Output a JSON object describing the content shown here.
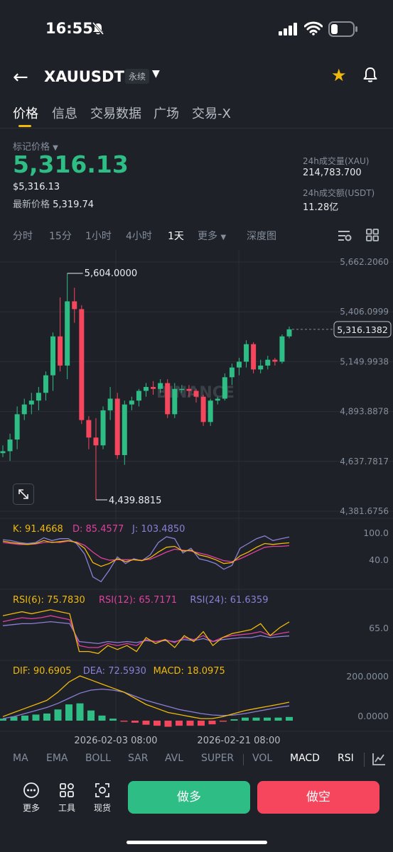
{
  "status": {
    "time": "16:55"
  },
  "header": {
    "symbol": "XAUUSDT",
    "contract_type": "永续"
  },
  "tabs": [
    "价格",
    "信息",
    "交易数据",
    "广场",
    "交易-X"
  ],
  "ticker": {
    "mark_label": "标记价格",
    "mark_price": "5,316.13",
    "usd_value": "$5,316.13",
    "last_price_label": "最新价格",
    "last_price": "5,319.74",
    "vol_base_label": "24h成交量(XAU)",
    "vol_base": "214,783.700",
    "vol_quote_label": "24h成交额(USDT)",
    "vol_quote": "11.28亿"
  },
  "intervals": [
    "分时",
    "15分",
    "1小时",
    "4小时",
    "1天",
    "更多",
    "深度图"
  ],
  "active_interval": "1天",
  "chart": {
    "price_axis": [
      "5,662.2060",
      "5,406.0999",
      "5,149.9938",
      "4,893.8878",
      "4,637.7817",
      "4,381.6756"
    ],
    "current_price_tag": "5,316.1382",
    "high_label": "5,604.0000",
    "low_label": "4,439.8815",
    "watermark": "BINANCE",
    "time_labels": [
      "2026-02-03 08:00",
      "2026-02-21 08:00"
    ],
    "kdj": {
      "k_label": "K: 91.4668",
      "d_label": "D: 85.4577",
      "j_label": "J: 103.4850",
      "axis": [
        "100.0",
        "40.0"
      ]
    },
    "rsi": {
      "rsi6_label": "RSI(6): 75.7830",
      "rsi12_label": "RSI(12): 65.7171",
      "rsi24_label": "RSI(24): 61.6359",
      "axis": [
        "65.0"
      ]
    },
    "macd": {
      "dif_label": "DIF: 90.6905",
      "dea_label": "DEA: 72.5930",
      "macd_label": "MACD: 18.0975",
      "axis": [
        "200.0000",
        "0.0000"
      ]
    },
    "colors": {
      "up": "#2ebd85",
      "down": "#f6465d",
      "k": "#f0b90b",
      "d": "#e040a0",
      "j": "#8b7fd6"
    }
  },
  "chart_data": {
    "type": "candlestick",
    "ylim": [
      4381.6756,
      5662.206
    ],
    "candles": [
      {
        "o": 4680,
        "h": 4720,
        "l": 4660,
        "c": 4690
      },
      {
        "o": 4690,
        "h": 4780,
        "l": 4640,
        "c": 4750
      },
      {
        "o": 4750,
        "h": 4920,
        "l": 4700,
        "c": 4880
      },
      {
        "o": 4880,
        "h": 4960,
        "l": 4850,
        "c": 4930
      },
      {
        "o": 4930,
        "h": 4990,
        "l": 4880,
        "c": 4950
      },
      {
        "o": 4950,
        "h": 5020,
        "l": 4900,
        "c": 4990
      },
      {
        "o": 4990,
        "h": 5100,
        "l": 4950,
        "c": 5080
      },
      {
        "o": 5080,
        "h": 5300,
        "l": 5000,
        "c": 5280
      },
      {
        "o": 5280,
        "h": 5480,
        "l": 5100,
        "c": 5130
      },
      {
        "o": 5130,
        "h": 5604,
        "l": 5060,
        "c": 5460
      },
      {
        "o": 5460,
        "h": 5530,
        "l": 5350,
        "c": 5420
      },
      {
        "o": 5420,
        "h": 5440,
        "l": 4830,
        "c": 4850
      },
      {
        "o": 4850,
        "h": 4870,
        "l": 4700,
        "c": 4760
      },
      {
        "o": 4760,
        "h": 4860,
        "l": 4439.8815,
        "c": 4720
      },
      {
        "o": 4720,
        "h": 4920,
        "l": 4700,
        "c": 4900
      },
      {
        "o": 4900,
        "h": 5020,
        "l": 4850,
        "c": 4960
      },
      {
        "o": 4960,
        "h": 4990,
        "l": 4650,
        "c": 4670
      },
      {
        "o": 4670,
        "h": 4950,
        "l": 4620,
        "c": 4930
      },
      {
        "o": 4930,
        "h": 4970,
        "l": 4900,
        "c": 4950
      },
      {
        "o": 4950,
        "h": 5010,
        "l": 4920,
        "c": 5000
      },
      {
        "o": 5000,
        "h": 5040,
        "l": 4970,
        "c": 5020
      },
      {
        "o": 5020,
        "h": 5050,
        "l": 4980,
        "c": 5010
      },
      {
        "o": 5010,
        "h": 5060,
        "l": 4990,
        "c": 5040
      },
      {
        "o": 5040,
        "h": 5060,
        "l": 4860,
        "c": 4880
      },
      {
        "o": 4880,
        "h": 5040,
        "l": 4860,
        "c": 5010
      },
      {
        "o": 5010,
        "h": 5030,
        "l": 4990,
        "c": 5010
      },
      {
        "o": 5010,
        "h": 5030,
        "l": 4970,
        "c": 5000
      },
      {
        "o": 5000,
        "h": 5010,
        "l": 4940,
        "c": 4970
      },
      {
        "o": 4970,
        "h": 4980,
        "l": 4820,
        "c": 4840
      },
      {
        "o": 4840,
        "h": 4960,
        "l": 4820,
        "c": 4950
      },
      {
        "o": 4950,
        "h": 4970,
        "l": 4930,
        "c": 4960
      },
      {
        "o": 4960,
        "h": 5090,
        "l": 4950,
        "c": 5070
      },
      {
        "o": 5070,
        "h": 5140,
        "l": 5030,
        "c": 5120
      },
      {
        "o": 5120,
        "h": 5170,
        "l": 5080,
        "c": 5150
      },
      {
        "o": 5150,
        "h": 5260,
        "l": 5120,
        "c": 5240
      },
      {
        "o": 5240,
        "h": 5250,
        "l": 5090,
        "c": 5110
      },
      {
        "o": 5110,
        "h": 5160,
        "l": 5090,
        "c": 5130
      },
      {
        "o": 5130,
        "h": 5180,
        "l": 5110,
        "c": 5160
      },
      {
        "o": 5160,
        "h": 5170,
        "l": 5130,
        "c": 5150
      },
      {
        "o": 5150,
        "h": 5290,
        "l": 5140,
        "c": 5280
      },
      {
        "o": 5280,
        "h": 5330,
        "l": 5270,
        "c": 5316.1382
      }
    ],
    "kdj": {
      "k": [
        95,
        92,
        90,
        88,
        90,
        96,
        92,
        94,
        96,
        92,
        80,
        50,
        42,
        48,
        58,
        52,
        56,
        54,
        60,
        72,
        82,
        84,
        74,
        76,
        66,
        62,
        56,
        48,
        50,
        64,
        72,
        82,
        90,
        88,
        90,
        91.4668
      ],
      "d": [
        92,
        90,
        88,
        88,
        89,
        92,
        93,
        92,
        95,
        93,
        86,
        72,
        60,
        55,
        56,
        56,
        56,
        55,
        57,
        64,
        72,
        78,
        76,
        74,
        70,
        66,
        60,
        54,
        52,
        58,
        66,
        74,
        82,
        84,
        84,
        85.4577
      ],
      "j": [
        98,
        96,
        92,
        90,
        92,
        102,
        96,
        100,
        100,
        90,
        68,
        20,
        10,
        34,
        62,
        48,
        58,
        54,
        66,
        92,
        104,
        100,
        70,
        80,
        58,
        54,
        48,
        36,
        44,
        80,
        90,
        100,
        106,
        96,
        100,
        103.485
      ]
    },
    "rsi": {
      "rsi6": [
        82,
        84,
        86,
        84,
        86,
        88,
        86,
        84,
        46,
        46,
        44,
        52,
        48,
        52,
        46,
        60,
        54,
        58,
        50,
        62,
        56,
        66,
        52,
        60,
        64,
        66,
        68,
        74,
        62,
        70,
        75.783
      ],
      "rsi12": [
        76,
        78,
        80,
        79,
        80,
        82,
        80,
        78,
        52,
        50,
        50,
        54,
        52,
        54,
        52,
        58,
        56,
        58,
        55,
        60,
        58,
        62,
        56,
        60,
        62,
        63,
        64,
        66,
        62,
        64,
        65.7171
      ],
      "rsi24": [
        72,
        73,
        74,
        74,
        75,
        76,
        75,
        74,
        56,
        55,
        54,
        56,
        55,
        56,
        55,
        57,
        56,
        57,
        56,
        58,
        57,
        59,
        56,
        58,
        59,
        60,
        60,
        62,
        60,
        61,
        61.6359
      ]
    },
    "macd": {
      "dif": [
        20,
        40,
        60,
        80,
        100,
        140,
        190,
        220,
        200,
        180,
        160,
        140,
        110,
        80,
        60,
        40,
        30,
        20,
        10,
        10,
        20,
        35,
        50,
        60,
        70,
        80,
        90.6905
      ],
      "dea": [
        10,
        20,
        35,
        50,
        65,
        85,
        110,
        135,
        150,
        155,
        150,
        140,
        120,
        100,
        85,
        70,
        55,
        45,
        35,
        28,
        25,
        28,
        35,
        45,
        55,
        65,
        72.593
      ],
      "hist": [
        10,
        20,
        25,
        30,
        35,
        55,
        80,
        85,
        50,
        25,
        10,
        -5,
        -10,
        -20,
        -25,
        -30,
        -25,
        -25,
        -25,
        -18,
        -5,
        7,
        15,
        15,
        15,
        15,
        18.0975
      ]
    }
  },
  "indicator_tabs": [
    "MA",
    "EMA",
    "BOLL",
    "SAR",
    "AVL",
    "SUPER",
    "VOL",
    "MACD",
    "RSI"
  ],
  "actions": {
    "more": "更多",
    "tools": "工具",
    "spot": "现货",
    "long": "做多",
    "short": "做空"
  }
}
